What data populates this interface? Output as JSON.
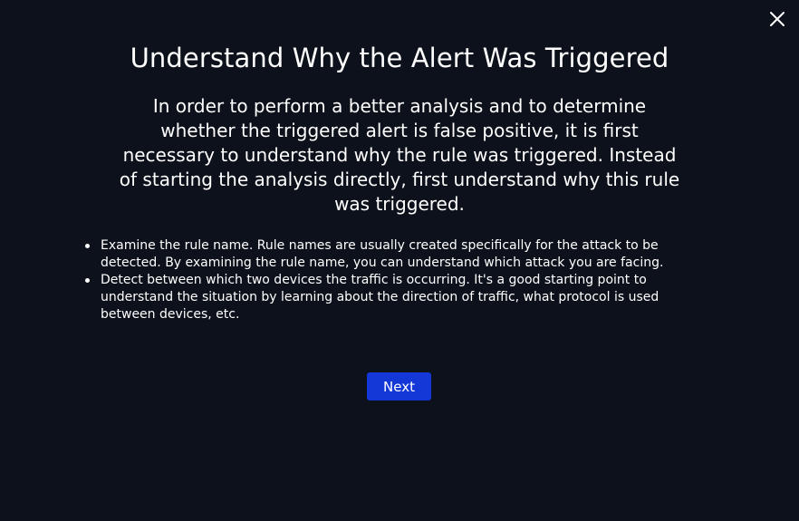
{
  "modal": {
    "title": "Understand Why the Alert Was Triggered",
    "intro": "In order to perform a better analysis and to determine whether the triggered alert is false positive, it is first necessary to understand why the rule was triggered. Instead of starting the analysis directly, first understand why this rule was triggered.",
    "bullets": [
      "Examine the rule name. Rule names are usually created specifically for the attack to be detected. By examining the rule name, you can understand which attack you are facing.",
      "Detect between which two devices the traffic is occurring. It's a good starting point to understand the situation by learning about the direction of traffic, what protocol is used between devices, etc."
    ],
    "next_label": "Next",
    "close_icon": "close-icon"
  },
  "colors": {
    "background": "#0d111b",
    "text": "#ffffff",
    "accent": "#1438d8"
  }
}
